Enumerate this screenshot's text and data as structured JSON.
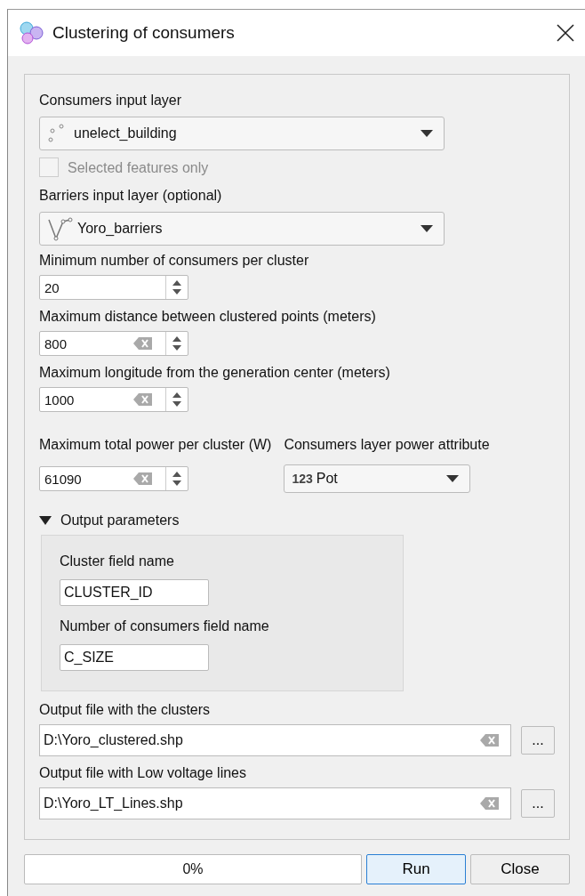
{
  "window": {
    "title": "Clustering of consumers"
  },
  "layers": [
    {
      "label": "Consumers input layer",
      "value": "unelect_building",
      "kind": "point",
      "selected_only": {
        "label": "Selected features only",
        "checked": false,
        "disabled": true
      }
    },
    {
      "label": "Barriers input layer (optional)",
      "value": "Yoro_barriers",
      "kind": "line"
    }
  ],
  "params": [
    {
      "label": "Minimum number of consumers per cluster",
      "value": "20",
      "clearable": false
    },
    {
      "label": "Maximum distance between clustered points (meters)",
      "value": "800",
      "clearable": true
    },
    {
      "label": "Maximum longitude from the generation center (meters)",
      "value": "1000",
      "clearable": true
    }
  ],
  "power": {
    "label": "Maximum total power per cluster (W)",
    "value": "61090",
    "clearable": true
  },
  "power_attribute": {
    "label": "Consumers layer power attribute",
    "type_badge": "123",
    "value": "Pot"
  },
  "output_parameters": {
    "label": "Output parameters",
    "expanded": true,
    "fields": [
      {
        "label": "Cluster field name",
        "value": "CLUSTER_ID"
      },
      {
        "label": "Number of consumers field name",
        "value": "C_SIZE"
      }
    ]
  },
  "output_files": [
    {
      "label": "Output file with the clusters",
      "value": "D:\\Yoro_clustered.shp",
      "browse": "..."
    },
    {
      "label": "Output file with Low voltage lines",
      "value": "D:\\Yoro_LT_Lines.shp",
      "browse": "..."
    }
  ],
  "progress": {
    "level": 0,
    "text": "0%"
  },
  "buttons": [
    {
      "label": "Run",
      "selected": true
    },
    {
      "label": "Close",
      "selected": false
    }
  ]
}
